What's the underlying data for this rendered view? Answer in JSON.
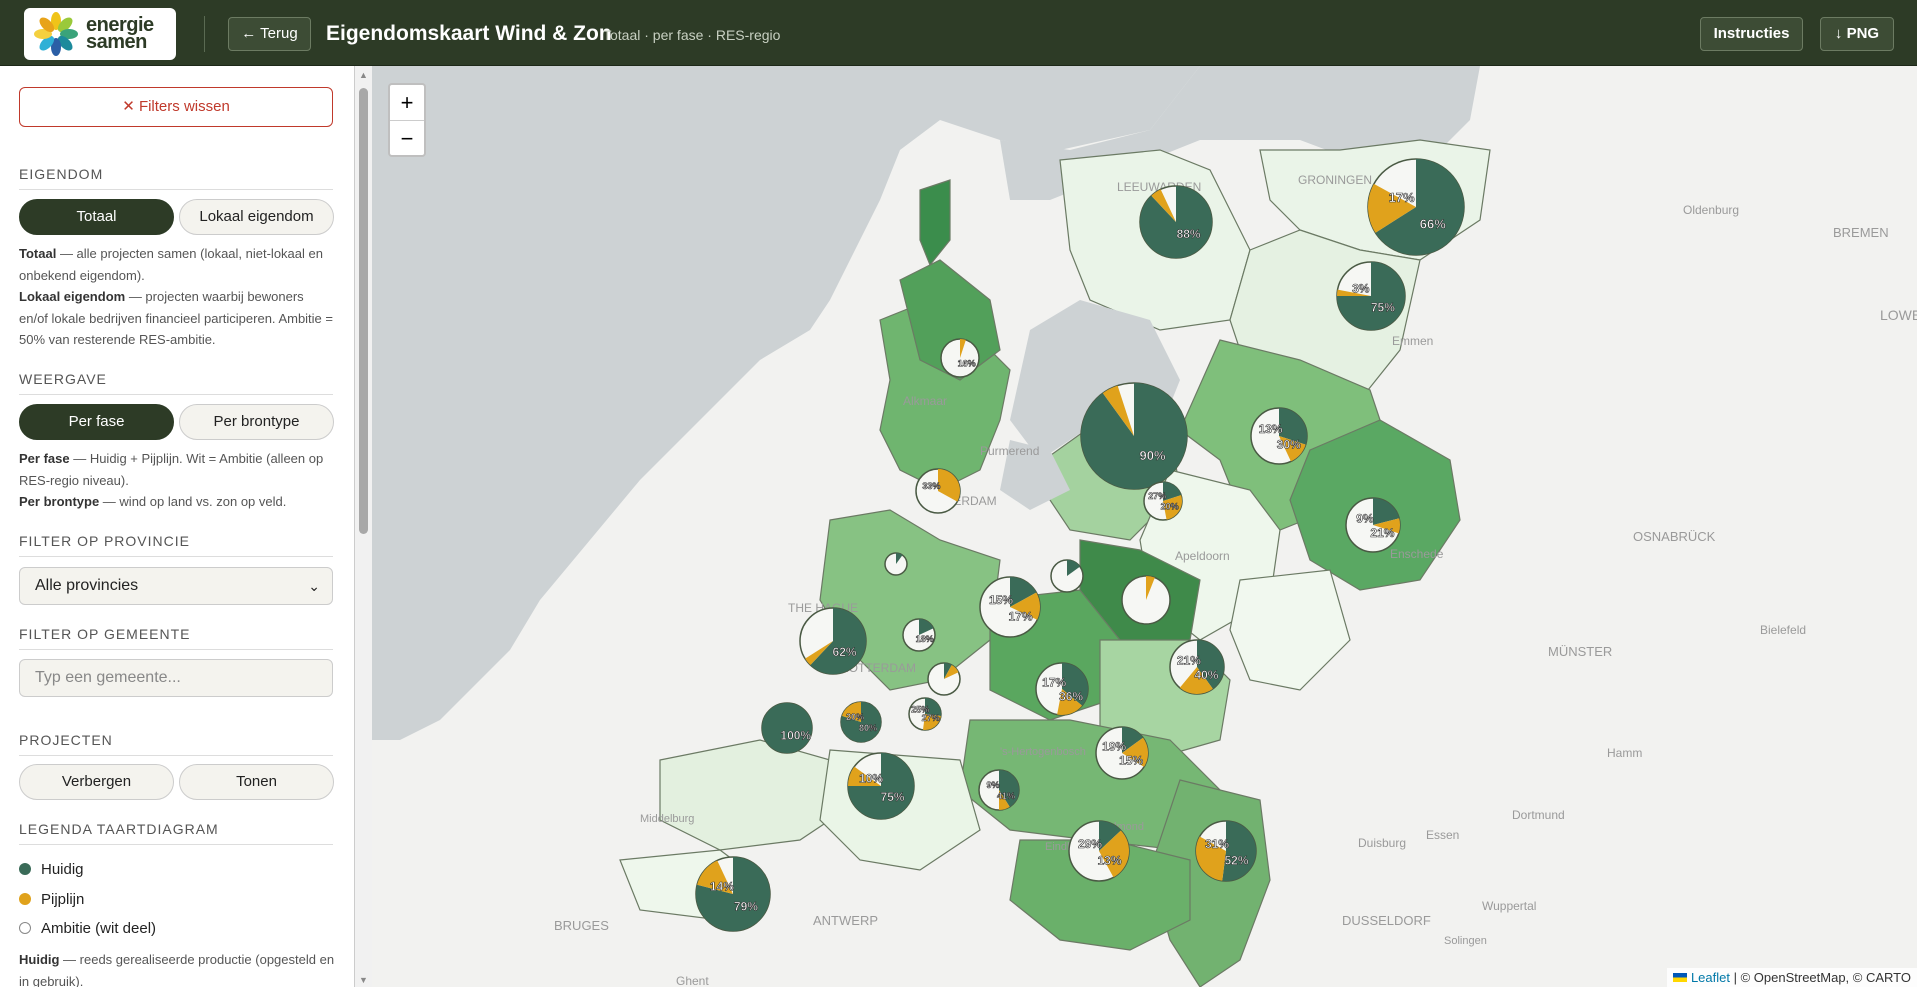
{
  "header": {
    "logo_line1": "energie",
    "logo_line2": "samen",
    "back_label": "← Terug",
    "title": "Eigendomskaart Wind & Zon",
    "subtitle": "Totaal · per fase · RES-regio",
    "instructions_label": "Instructies",
    "png_label": "↓ PNG"
  },
  "sidebar": {
    "clear_filters": "✕ Filters wissen",
    "eigendom": {
      "label": "EIGENDOM",
      "option_total": "Totaal",
      "option_local": "Lokaal eigendom",
      "active": "Totaal",
      "desc_total_term": "Totaal",
      "desc_total": " — alle projecten samen (lokaal, niet-lokaal en onbekend eigendom).",
      "desc_local_term": "Lokaal eigendom",
      "desc_local": " — projecten waarbij bewoners en/of lokale bedrijven financieel participeren. Ambitie = 50% van resterende RES-ambitie."
    },
    "weergave": {
      "label": "WEERGAVE",
      "option_phase": "Per fase",
      "option_source": "Per brontype",
      "active": "Per fase",
      "desc_phase_term": "Per fase",
      "desc_phase": " — Huidig + Pijplijn. Wit = Ambitie (alleen op RES-regio niveau).",
      "desc_source_term": "Per brontype",
      "desc_source": " — wind op land vs. zon op veld."
    },
    "provincie": {
      "label": "FILTER OP PROVINCIE",
      "selected": "Alle provincies"
    },
    "gemeente": {
      "label": "FILTER OP GEMEENTE",
      "placeholder": "Typ een gemeente..."
    },
    "projecten": {
      "label": "PROJECTEN",
      "hide": "Verbergen",
      "show": "Tonen"
    },
    "legend": {
      "label": "LEGENDA TAARTDIAGRAM",
      "items": [
        {
          "label": "Huidig",
          "color": "#3a6b58"
        },
        {
          "label": "Pijplijn",
          "color": "#e0a21c"
        },
        {
          "label": "Ambitie (wit deel)",
          "color": "#ffffff"
        }
      ],
      "huidig_term": "Huidig",
      "huidig_desc": " — reeds gerealiseerde productie (opgesteld en in gebruik)."
    }
  },
  "map": {
    "colors": {
      "sea": "#cdd2d4",
      "land": "#f2f2f0",
      "huidig": "#3a6b58",
      "pijplijn": "#e0a21c"
    },
    "zoom_in": "+",
    "zoom_out": "−",
    "attribution_link": "Leaflet",
    "attribution_rest": " | © OpenStreetMap, © CARTO",
    "place_labels": [
      "LEEUWARDEN",
      "GRONINGEN",
      "Emmen",
      "Alkmaar",
      "Purmerend",
      "AMSTERDAM",
      "THE HAGUE",
      "ROTTERDAM",
      "Apeldoorn",
      "Enschede",
      "Oldenburg",
      "BREMEN",
      "LOWER SAXONY",
      "OSNABRÜCK",
      "MÜNSTER",
      "Bielefeld",
      "Hamm",
      "Dortmund",
      "Essen",
      "Duisburg",
      "Wuppertal",
      "DUSSELDORF",
      "Solingen",
      "BRUGES",
      "ANTWERP",
      "Ghent",
      "Middelburg",
      "'s-Hertogenbosch",
      "Helmond",
      "Eindhoven"
    ],
    "pies": [
      {
        "huidig": 88,
        "pijplijn": 5,
        "label_h": "88%",
        "label_p": ""
      },
      {
        "huidig": 66,
        "pijplijn": 17,
        "label_h": "66%",
        "label_p": "17%"
      },
      {
        "huidig": 75,
        "pijplijn": 3,
        "label_h": "75%",
        "label_p": "3%"
      },
      {
        "huidig": 0,
        "pijplijn": 5,
        "label_h": "16%",
        "label_p": ""
      },
      {
        "huidig": 90,
        "pijplijn": 5,
        "label_h": "90%",
        "label_p": ""
      },
      {
        "huidig": 30,
        "pijplijn": 13,
        "label_h": "30%",
        "label_p": "13%"
      },
      {
        "huidig": 0,
        "pijplijn": 33,
        "label_h": "",
        "label_p": "33%"
      },
      {
        "huidig": 20,
        "pijplijn": 27,
        "label_h": "20%",
        "label_p": "27%"
      },
      {
        "huidig": 21,
        "pijplijn": 9,
        "label_h": "21%",
        "label_p": "9%"
      },
      {
        "huidig": 15,
        "pijplijn": 0,
        "label_h": "",
        "label_p": ""
      },
      {
        "huidig": 17,
        "pijplijn": 15,
        "label_h": "17%",
        "label_p": "15%"
      },
      {
        "huidig": 10,
        "pijplijn": 0,
        "label_h": "",
        "label_p": ""
      },
      {
        "huidig": 0,
        "pijplijn": 6,
        "label_h": "",
        "label_p": ""
      },
      {
        "huidig": 62,
        "pijplijn": 4,
        "label_h": "62%",
        "label_p": ""
      },
      {
        "huidig": 18,
        "pijplijn": 0,
        "label_h": "18%",
        "label_p": ""
      },
      {
        "huidig": 8,
        "pijplijn": 10,
        "label_h": "",
        "label_p": ""
      },
      {
        "huidig": 36,
        "pijplijn": 17,
        "label_h": "36%",
        "label_p": "17%"
      },
      {
        "huidig": 40,
        "pijplijn": 21,
        "label_h": "40%",
        "label_p": "21%"
      },
      {
        "huidig": 100,
        "pijplijn": 0,
        "label_h": "100%",
        "label_p": ""
      },
      {
        "huidig": 80,
        "pijplijn": 20,
        "label_h": "80%",
        "label_p": "20%"
      },
      {
        "huidig": 27,
        "pijplijn": 25,
        "label_h": "27%",
        "label_p": "25%"
      },
      {
        "huidig": 75,
        "pijplijn": 10,
        "label_h": "75%",
        "label_p": "10%"
      },
      {
        "huidig": 41,
        "pijplijn": 9,
        "label_h": "41%",
        "label_p": "9%"
      },
      {
        "huidig": 15,
        "pijplijn": 19,
        "label_h": "15%",
        "label_p": "19%"
      },
      {
        "huidig": 13,
        "pijplijn": 29,
        "label_h": "13%",
        "label_p": "29%"
      },
      {
        "huidig": 52,
        "pijplijn": 31,
        "label_h": "52%",
        "label_p": "31%"
      },
      {
        "huidig": 79,
        "pijplijn": 14,
        "label_h": "79%",
        "label_p": "14%"
      }
    ]
  }
}
